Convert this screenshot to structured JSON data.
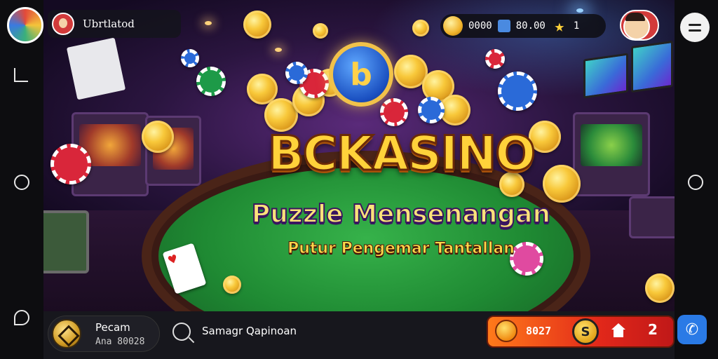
{
  "top_bar": {
    "username": "Ubrtlatod",
    "coins": "0000",
    "gems": "80.00",
    "stars": "1"
  },
  "hero": {
    "title": "BCKASINO",
    "subtitle": "Puzzle Mensenangan",
    "tagline": "Putur Pengemar Tantallan",
    "logo_letter": "b"
  },
  "bottom_bar": {
    "player_name": "Pecam",
    "player_id": "Ana 80028",
    "search_text": "Samagr Qapinoan",
    "balance": "8027",
    "token_symbol": "S",
    "hook_glyph": "2"
  },
  "icons": {
    "star": "★",
    "phone": "✆"
  },
  "colors": {
    "accent_gold": "#ffd23a",
    "felt_green": "#1f8a33",
    "action_red": "#e2281a",
    "phone_blue": "#2a7ae6"
  }
}
